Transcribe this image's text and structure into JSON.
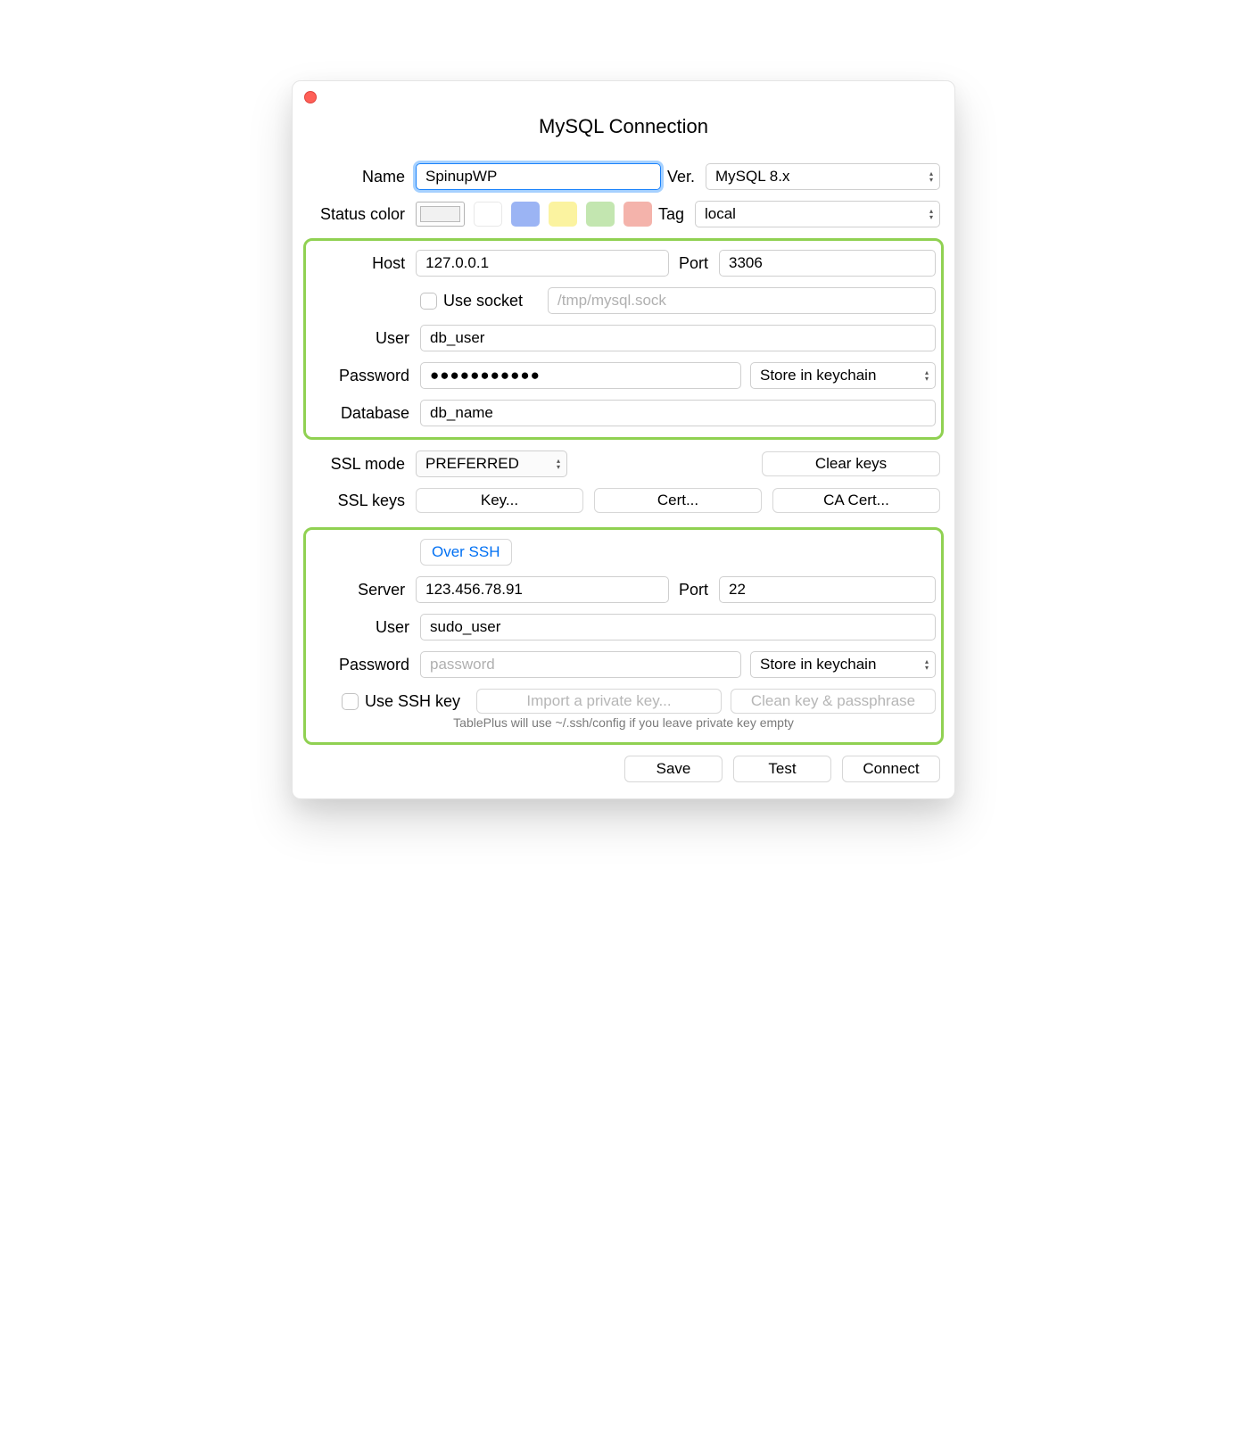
{
  "window": {
    "title": "MySQL Connection"
  },
  "fields": {
    "name_label": "Name",
    "name_value": "SpinupWP",
    "ver_label": "Ver.",
    "ver_value": "MySQL 8.x",
    "status_color_label": "Status color",
    "tag_label": "Tag",
    "tag_value": "local",
    "host_label": "Host",
    "host_value": "127.0.0.1",
    "port_label": "Port",
    "port_value": "3306",
    "use_socket_label": "Use socket",
    "socket_placeholder": "/tmp/mysql.sock",
    "user_label": "User",
    "user_value": "db_user",
    "password_label": "Password",
    "password_value": "●●●●●●●●●●●",
    "keychain_value": "Store in keychain",
    "database_label": "Database",
    "database_value": "db_name",
    "ssl_mode_label": "SSL mode",
    "ssl_mode_value": "PREFERRED",
    "clear_keys_label": "Clear keys",
    "ssl_keys_label": "SSL keys",
    "key_btn": "Key...",
    "cert_btn": "Cert...",
    "ca_cert_btn": "CA Cert..."
  },
  "ssh": {
    "over_ssh_label": "Over SSH",
    "server_label": "Server",
    "server_value": "123.456.78.91",
    "port_label": "Port",
    "port_value": "22",
    "user_label": "User",
    "user_value": "sudo_user",
    "password_label": "Password",
    "password_placeholder": "password",
    "keychain_value": "Store in keychain",
    "use_ssh_key_label": "Use SSH key",
    "import_key_btn": "Import a private key...",
    "clean_key_btn": "Clean key & passphrase",
    "note": "TablePlus will use ~/.ssh/config if you leave private key empty"
  },
  "footer": {
    "save": "Save",
    "test": "Test",
    "connect": "Connect"
  },
  "colors": {
    "swatches": [
      "#ffffff",
      "#7f9cf5",
      "#fef08a",
      "#bbf7d0",
      "#fca5a5"
    ]
  }
}
